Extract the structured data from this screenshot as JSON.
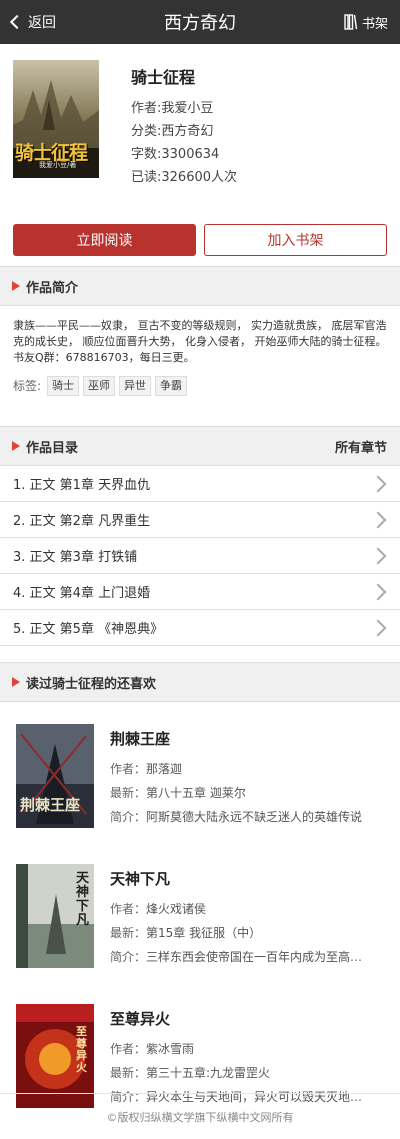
{
  "header": {
    "back_label": "返回",
    "title": "西方奇幻",
    "shelf_label": "书架"
  },
  "book": {
    "name": "骑士征程",
    "author": "作者:我爱小豆",
    "category": "分类:西方奇幻",
    "words": "字数:3300634",
    "reads": "已读:326600人次",
    "cover_title": "骑士征程",
    "cover_sub": "我爱小豆/著"
  },
  "actions": {
    "read_label": "立即阅读",
    "add_label": "加入书架"
  },
  "intro_section": {
    "title": "作品简介",
    "text": "隶族——平民——奴隶， 亘古不变的等级规则， 实力造就贵族， 底层军官浩克的成长史， 顺应位面晋升大势， 化身入侵者， 开始巫师大陆的骑士征程。 书友Q群：678816703，每日三更。",
    "tags_label": "标签:",
    "tags": [
      "骑士",
      "巫师",
      "异世",
      "争霸"
    ]
  },
  "catalog_section": {
    "title": "作品目录",
    "more": "所有章节",
    "chapters": [
      "1. 正文 第1章 天界血仇",
      "2. 正文 第2章 凡界重生",
      "3. 正文 第3章 打铁铺",
      "4. 正文 第4章 上门退婚",
      "5. 正文 第5章 《神恩典》"
    ]
  },
  "rec_section": {
    "title": "读过骑士征程的还喜欢",
    "items": [
      {
        "name": "荆棘王座",
        "author_label": "作者：",
        "author": "那落迦",
        "latest_label": "最新：",
        "latest": "第八十五章 迦莱尔",
        "intro_label": "简介：",
        "intro": "阿斯莫德大陆永远不缺乏迷人的英雄传说",
        "cover_text": "荆棘王座"
      },
      {
        "name": "天神下凡",
        "author_label": "作者：",
        "author": "烽火戏诸侯",
        "latest_label": "最新：",
        "latest": "第15章 我征服（中）",
        "intro_label": "简介：",
        "intro": "三样东西会使帝国在一百年内成为至高无上",
        "cover_text": "天神下凡"
      },
      {
        "name": "至尊异火",
        "author_label": "作者：",
        "author": "紫冰雪雨",
        "latest_label": "最新：",
        "latest": "第三十五章:九龙雷罡火",
        "intro_label": "简介：",
        "intro": "异火本生与天地间，异火可以毁天灭地，焚烧万物",
        "cover_text": "至尊异火"
      }
    ]
  },
  "footer": {
    "text": "©版权归纵横文学旗下纵横中文网所有"
  }
}
